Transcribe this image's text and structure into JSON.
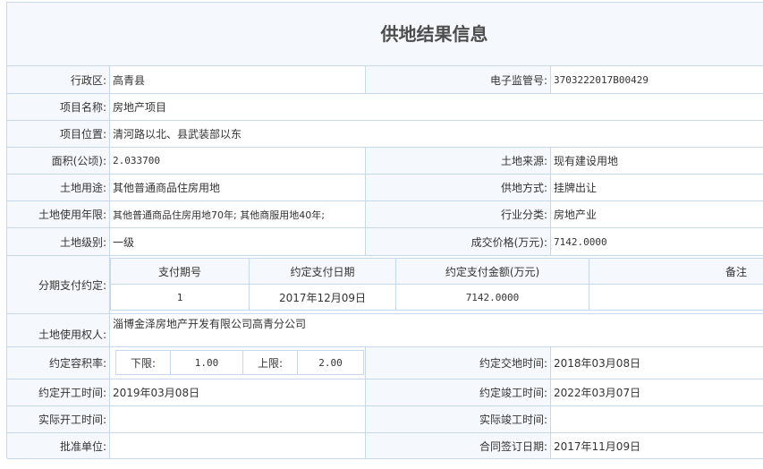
{
  "title": "供地结果信息",
  "fields": {
    "district": {
      "label": "行政区:",
      "value": "高青县"
    },
    "supervision_no": {
      "label": "电子监管号:",
      "value": "3703222017B00429"
    },
    "project_name": {
      "label": "项目名称:",
      "value": "房地产项目"
    },
    "project_location": {
      "label": "项目位置:",
      "value": "清河路以北、县武装部以东"
    },
    "area": {
      "label": "面积(公顷):",
      "value": "2.033700"
    },
    "land_source": {
      "label": "土地来源:",
      "value": "现有建设用地"
    },
    "land_use": {
      "label": "土地用途:",
      "value": "其他普通商品住房用地"
    },
    "supply_method": {
      "label": "供地方式:",
      "value": "挂牌出让"
    },
    "use_term": {
      "label": "土地使用年限:",
      "value": "其他普通商品住房用地70年; 其他商服用地40年;"
    },
    "industry": {
      "label": "行业分类:",
      "value": "房地产业"
    },
    "land_level": {
      "label": "土地级别:",
      "value": "一级"
    },
    "price": {
      "label": "成交价格(万元):",
      "value": "7142.0000"
    },
    "installment": {
      "label": "分期支付约定:",
      "headers": [
        "支付期号",
        "约定支付日期",
        "约定支付金额(万元)",
        "备注"
      ],
      "rows": [
        [
          "1",
          "2017年12月09日",
          "7142.0000",
          ""
        ]
      ]
    },
    "land_user": {
      "label": "土地使用权人:",
      "value": "淄博金泽房地产开发有限公司高青分公司"
    },
    "far": {
      "label": "约定容积率:",
      "lower_label": "下限:",
      "lower": "1.00",
      "upper_label": "上限:",
      "upper": "2.00"
    },
    "delivery_time": {
      "label": "约定交地时间:",
      "value": "2018年03月08日"
    },
    "start_time": {
      "label": "约定开工时间:",
      "value": "2019年03月08日"
    },
    "finish_time": {
      "label": "约定竣工时间:",
      "value": "2022年03月07日"
    },
    "actual_start": {
      "label": "实际开工时间:",
      "value": ""
    },
    "actual_finish": {
      "label": "实际竣工时间:",
      "value": ""
    },
    "approval_unit": {
      "label": "批准单位:",
      "value": ""
    },
    "contract_date": {
      "label": "合同签订日期:",
      "value": "2017年11月09日"
    }
  }
}
